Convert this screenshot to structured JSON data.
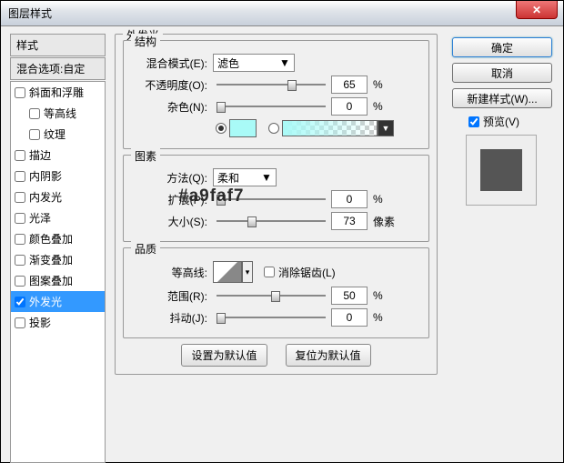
{
  "window": {
    "title": "图层样式"
  },
  "sidebar": {
    "header": "样式",
    "subheader": "混合选项:自定",
    "items": [
      {
        "label": "斜面和浮雕",
        "checked": false,
        "sel": false,
        "indent": false
      },
      {
        "label": "等高线",
        "checked": false,
        "sel": false,
        "indent": true
      },
      {
        "label": "纹理",
        "checked": false,
        "sel": false,
        "indent": true
      },
      {
        "label": "描边",
        "checked": false,
        "sel": false,
        "indent": false
      },
      {
        "label": "内阴影",
        "checked": false,
        "sel": false,
        "indent": false
      },
      {
        "label": "内发光",
        "checked": false,
        "sel": false,
        "indent": false
      },
      {
        "label": "光泽",
        "checked": false,
        "sel": false,
        "indent": false
      },
      {
        "label": "颜色叠加",
        "checked": false,
        "sel": false,
        "indent": false
      },
      {
        "label": "渐变叠加",
        "checked": false,
        "sel": false,
        "indent": false
      },
      {
        "label": "图案叠加",
        "checked": false,
        "sel": false,
        "indent": false
      },
      {
        "label": "外发光",
        "checked": true,
        "sel": true,
        "indent": false
      },
      {
        "label": "投影",
        "checked": false,
        "sel": false,
        "indent": false
      }
    ]
  },
  "main": {
    "title": "外发光",
    "structure": {
      "title": "结构",
      "blend_label": "混合模式(E):",
      "blend_value": "滤色",
      "opacity_label": "不透明度(O):",
      "opacity_value": "65",
      "opacity_unit": "%",
      "noise_label": "杂色(N):",
      "noise_value": "0",
      "noise_unit": "%",
      "swatch_color": "#a9faf7"
    },
    "elements": {
      "title": "图素",
      "technique_label": "方法(Q):",
      "technique_value": "柔和",
      "spread_label": "扩展(P):",
      "spread_value": "0",
      "spread_unit": "%",
      "size_label": "大小(S):",
      "size_value": "73",
      "size_unit": "像素"
    },
    "quality": {
      "title": "品质",
      "contour_label": "等高线:",
      "anti_label": "消除锯齿(L)",
      "range_label": "范围(R):",
      "range_value": "50",
      "range_unit": "%",
      "jitter_label": "抖动(J):",
      "jitter_value": "0",
      "jitter_unit": "%"
    },
    "defaults": {
      "set": "设置为默认值",
      "reset": "复位为默认值"
    }
  },
  "right": {
    "ok": "确定",
    "cancel": "取消",
    "new_style": "新建样式(W)...",
    "preview": "预览(V)"
  },
  "overlay_hex": "#a9faf7"
}
